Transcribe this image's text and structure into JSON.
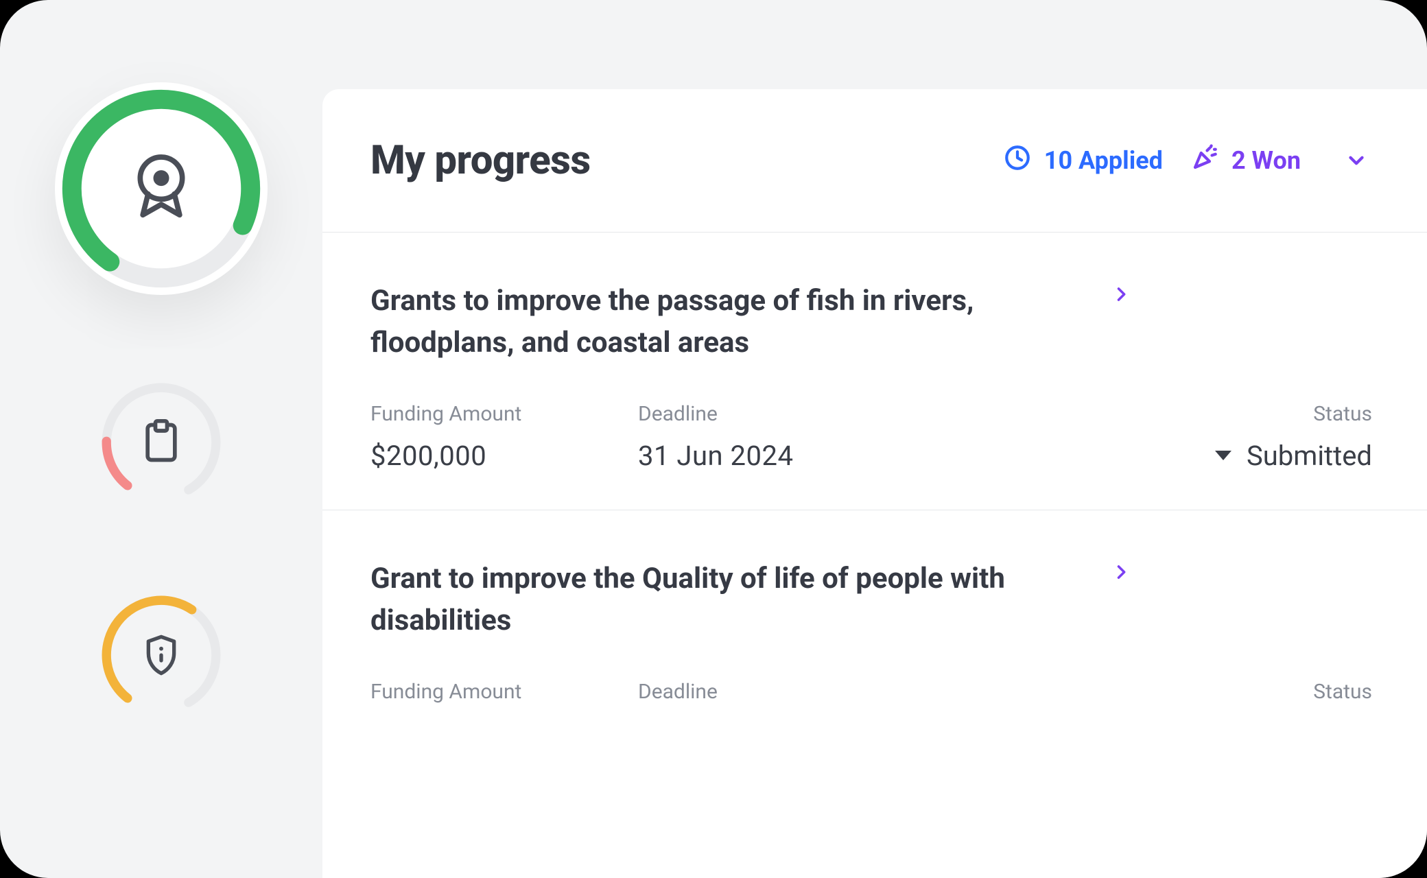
{
  "header": {
    "title": "My progress",
    "applied_count": "10 Applied",
    "won_count": "2 Won"
  },
  "sidebar": {
    "items": [
      {
        "icon": "award-badge-icon",
        "ring_color": "#3bb763",
        "progress": 0.8
      },
      {
        "icon": "clipboard-icon",
        "ring_color": "#f48a8a",
        "progress": 0.18
      },
      {
        "icon": "shield-info-icon",
        "ring_color": "#f3b33a",
        "progress": 0.6
      }
    ]
  },
  "labels": {
    "funding": "Funding Amount",
    "deadline": "Deadline",
    "status": "Status"
  },
  "grants": [
    {
      "title": "Grants to improve the passage of fish in rivers, floodplans, and coastal areas",
      "funding": "$200,000",
      "deadline": "31 Jun 2024",
      "status": "Submitted"
    },
    {
      "title": "Grant to improve the Quality of life of people with disabilities",
      "funding": "",
      "deadline": "",
      "status": ""
    }
  ],
  "colors": {
    "applied": "#2c6bff",
    "won": "#7b3ff2",
    "ring_bg": "#e8e9eb"
  }
}
